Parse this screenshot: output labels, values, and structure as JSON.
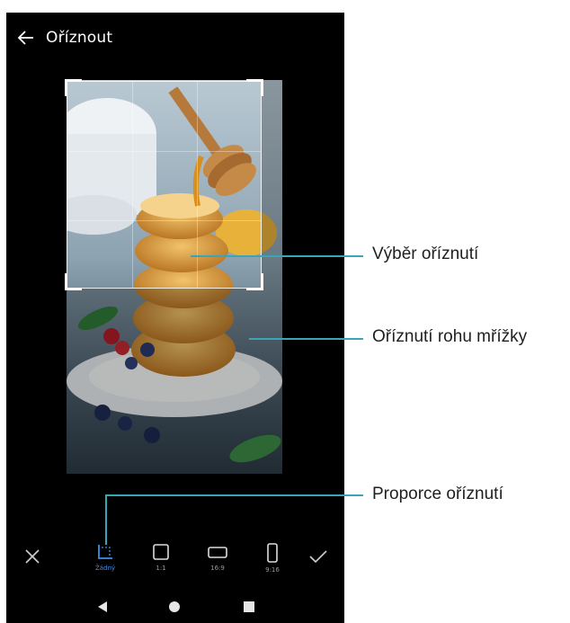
{
  "header": {
    "title": "Oříznout"
  },
  "ratio_options": [
    {
      "label": "Žádný",
      "icon": "free-crop-icon",
      "selected": true
    },
    {
      "label": "1:1",
      "icon": "square-ratio-icon",
      "selected": false
    },
    {
      "label": "16:9",
      "icon": "landscape-ratio-icon",
      "selected": false
    },
    {
      "label": "9:16",
      "icon": "portrait-ratio-icon",
      "selected": false
    }
  ],
  "annotations": {
    "crop_selection": "Výběr oříznutí",
    "grid_corner": "Oříznutí rohu mřížky",
    "crop_ratio": "Proporce oříznutí"
  },
  "colors": {
    "accent": "#3d8fe8",
    "leader": "#3aa6b5",
    "background": "#000000"
  }
}
